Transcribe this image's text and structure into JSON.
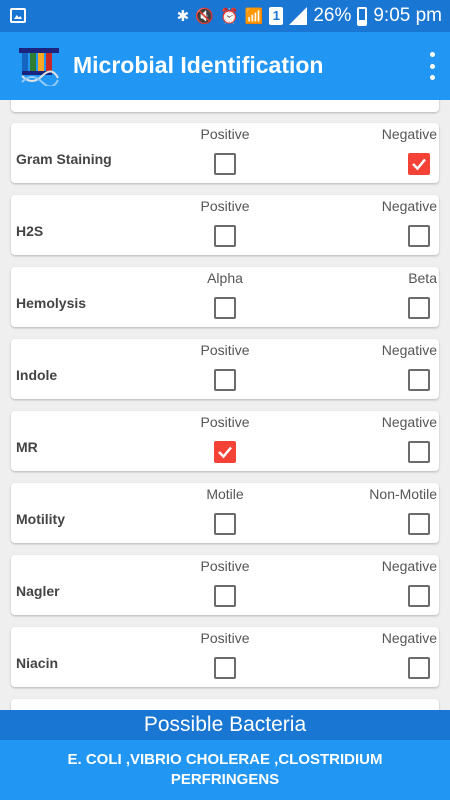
{
  "status_bar": {
    "battery": "26%",
    "time": "9:05 pm",
    "sim_label": "1",
    "icons": [
      "gallery-icon",
      "bluetooth-icon",
      "mute-icon",
      "alarm-icon",
      "wifi-icon",
      "sim-icon",
      "signal-icon",
      "battery-icon"
    ]
  },
  "app_bar": {
    "title": "Microbial Identification"
  },
  "tests": [
    {
      "name": "Gram Staining",
      "option1": "Positive",
      "option2": "Negative",
      "option1_checked": false,
      "option2_checked": true
    },
    {
      "name": "H2S",
      "option1": "Positive",
      "option2": "Negative",
      "option1_checked": false,
      "option2_checked": false
    },
    {
      "name": "Hemolysis",
      "option1": "Alpha",
      "option2": "Beta",
      "option1_checked": false,
      "option2_checked": false
    },
    {
      "name": "Indole",
      "option1": "Positive",
      "option2": "Negative",
      "option1_checked": false,
      "option2_checked": false
    },
    {
      "name": "MR",
      "option1": "Positive",
      "option2": "Negative",
      "option1_checked": true,
      "option2_checked": false
    },
    {
      "name": "Motility",
      "option1": "Motile",
      "option2": "Non-Motile",
      "option1_checked": false,
      "option2_checked": false
    },
    {
      "name": "Nagler",
      "option1": "Positive",
      "option2": "Negative",
      "option1_checked": false,
      "option2_checked": false
    },
    {
      "name": "Niacin",
      "option1": "Positive",
      "option2": "Negative",
      "option1_checked": false,
      "option2_checked": false
    }
  ],
  "result": {
    "header": "Possible Bacteria",
    "text": "E. COLI ,VIBRIO CHOLERAE ,CLOSTRIDIUM PERFRINGENS"
  },
  "colors": {
    "primary": "#2196f3",
    "primary_dark": "#1976d2",
    "accent": "#f44336",
    "background": "#efefef"
  }
}
